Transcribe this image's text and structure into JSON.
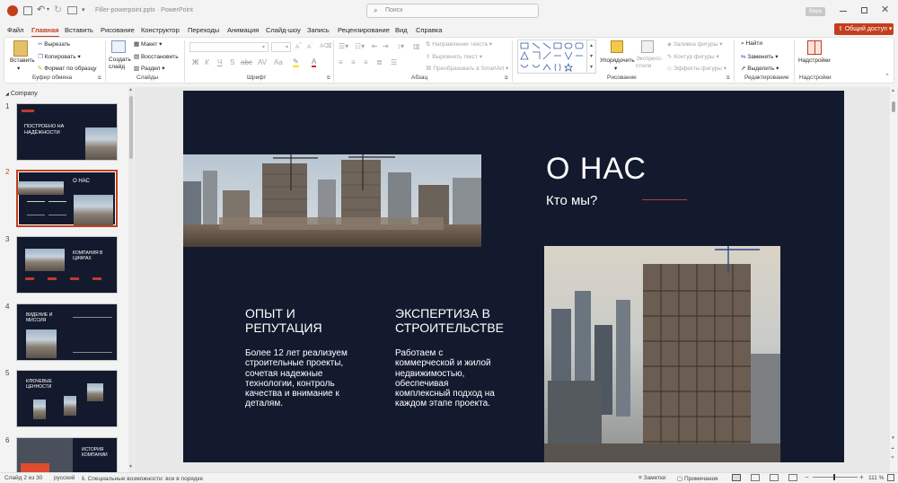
{
  "titlebar": {
    "autosave_label": "",
    "filename": "Filler-powerpoint.pptx",
    "app": "PowerPoint",
    "separator": "·",
    "search_placeholder": "Поиск",
    "user": "Вера"
  },
  "menu": {
    "tabs": [
      "Файл",
      "Главная",
      "Вставить",
      "Рисование",
      "Конструктор",
      "Переходы",
      "Анимация",
      "Слайд-шоу",
      "Запись",
      "Рецензирование",
      "Вид",
      "Справка"
    ],
    "share_label": "Общий доступ"
  },
  "ribbon": {
    "paste": "Вставить",
    "cut": "Вырезать",
    "copy": "Копировать",
    "format_painter": "Формат по образцу",
    "clipboard_group": "Буфер обмена",
    "new_slide": "Создать слайд",
    "layout": "Макет",
    "reset": "Восстановить",
    "section": "Раздел",
    "slides_group": "Слайды",
    "font_group": "Шрифт",
    "text_direction": "Направление текста",
    "align_text": "Выровнять текст",
    "smartart": "Преобразовать в SmartArt",
    "paragraph_group": "Абзац",
    "arrange": "Упорядочить",
    "quick_styles": "Экспресс-стили",
    "shape_fill": "Заливка фигуры",
    "shape_outline": "Контур фигуры",
    "shape_effects": "Эффекты фигуры",
    "drawing_group": "Рисование",
    "find": "Найти",
    "replace": "Заменить",
    "select": "Выделить",
    "editing_group": "Редактирование",
    "addins": "Надстройки",
    "addins_group": "Надстройки"
  },
  "panel": {
    "section_name": "Company",
    "slides": [
      {
        "num": "1",
        "title": "ПОСТРОЕНО НА НАДЁЖНОСТИ"
      },
      {
        "num": "2",
        "title": "О НАС"
      },
      {
        "num": "3",
        "title": "КОМПАНИЯ В ЦИФРАХ"
      },
      {
        "num": "4",
        "title": "ВИДЕНИЕ И МИССИЯ"
      },
      {
        "num": "5",
        "title": "КЛЮЧЕВЫЕ ЦЕННОСТИ"
      },
      {
        "num": "6",
        "title": "ИСТОРИЯ КОМПАНИИ"
      }
    ]
  },
  "slide": {
    "title": "О НАС",
    "subtitle": "Кто мы?",
    "col1_heading": "ОПЫТ И\nРЕПУТАЦИЯ",
    "col1_body": "Более 12 лет реализуем строительные проекты, сочетая надежные технологии, контроль качества и внимание к деталям.",
    "col2_heading": "ЭКСПЕРТИЗА В\nСТРОИТЕЛЬСТВЕ",
    "col2_body": "Работаем с коммерческой и жилой недвижимостью, обеспечивая комплексный подход на каждом этапе проекта.",
    "accent_color": "#c0392b",
    "bg_color": "#141a2e"
  },
  "status": {
    "slide_of": "Слайд 2 из 30",
    "language": "русский",
    "accessibility": "Специальные возможности: все в порядке",
    "notes": "Заметки",
    "comments": "Примечания",
    "zoom": "111 %"
  }
}
